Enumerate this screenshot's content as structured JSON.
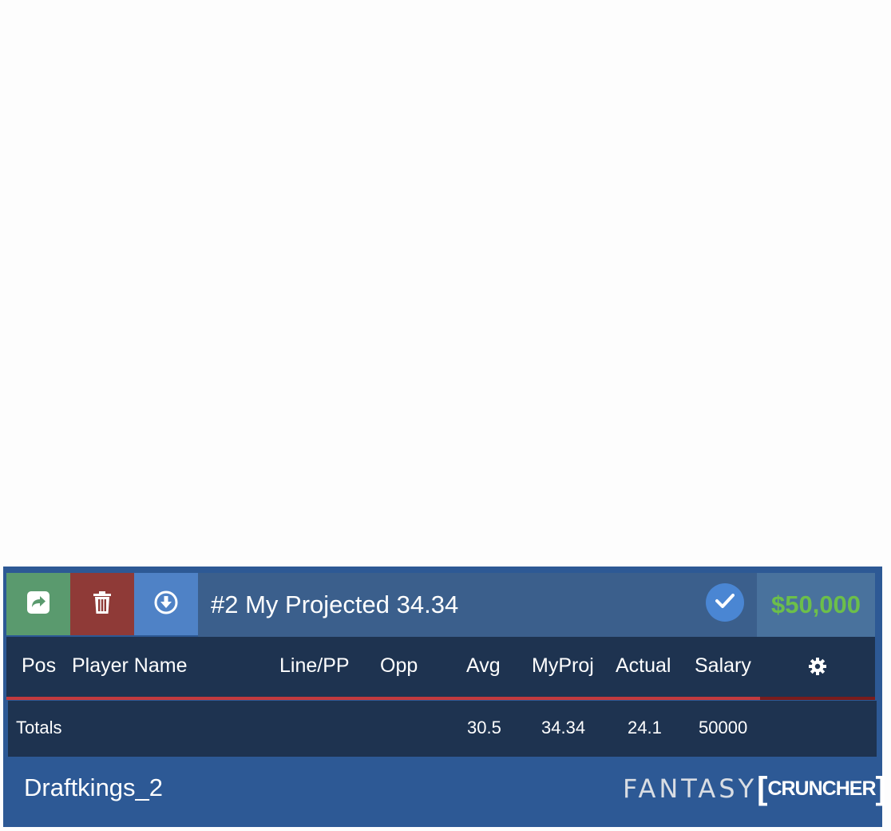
{
  "toolbar": {
    "share_icon": "share-icon",
    "delete_icon": "trash-icon",
    "download_icon": "download-circle-icon",
    "lineup_title": "#2 My Projected 34.34",
    "confirm_icon": "check-circle-icon",
    "salary_cap": "$50,000"
  },
  "table": {
    "headers": {
      "pos": "Pos",
      "player_name": "Player Name",
      "line_pp": "Line/PP",
      "opp": "Opp",
      "avg": "Avg",
      "myproj": "MyProj",
      "actual": "Actual",
      "salary": "Salary"
    },
    "totals": {
      "label": "Totals",
      "avg": "30.5",
      "myproj": "34.34",
      "actual": "24.1",
      "salary": "50000"
    }
  },
  "footer": {
    "lineup_name": "Draftkings_2",
    "brand_fantasy": "FANTASY",
    "brand_cruncher": "CRUNCHER"
  },
  "colors": {
    "panel": "#2d5995",
    "share": "#5a9a6e",
    "delete": "#8f3a37",
    "download": "#4f82c6",
    "salary_text": "#6cbf4a",
    "header_bg": "#1e3350",
    "accent_red": "#c33a3e"
  }
}
